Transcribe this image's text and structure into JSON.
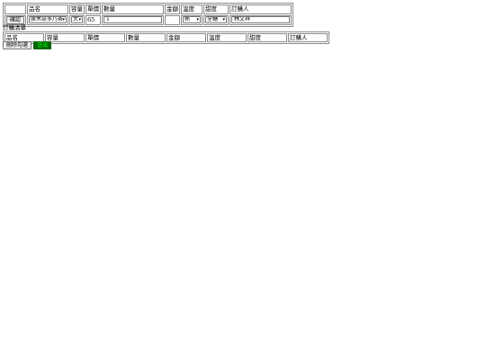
{
  "form": {
    "headers": [
      "",
      "品名",
      "容量",
      "單價",
      "數量",
      "金額",
      "溫度",
      "甜度",
      "訂購人"
    ],
    "confirm_label": "確認",
    "product_value": "原木奈多乃茶",
    "size_value": "大",
    "price_value": "65",
    "quantity_value": "1",
    "amount_value": "",
    "temperature_value": "熱",
    "sweetness_value": "全糖",
    "orderer_value": "林文祥"
  },
  "list": {
    "title": "訂購清單",
    "headers": [
      "品名",
      "容量",
      "單價",
      "數量",
      "金額",
      "溫度",
      "甜度",
      "訂購人"
    ],
    "delete_label": "刪除勾選",
    "submit_label": "送出"
  }
}
